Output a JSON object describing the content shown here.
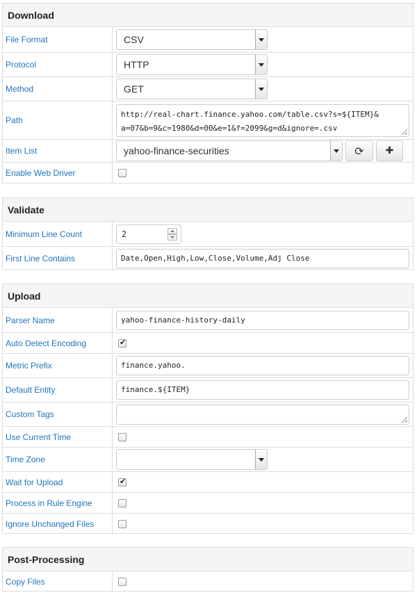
{
  "download": {
    "title": "Download",
    "file_format": {
      "label": "File Format",
      "value": "CSV"
    },
    "protocol": {
      "label": "Protocol",
      "value": "HTTP"
    },
    "method": {
      "label": "Method",
      "value": "GET"
    },
    "path": {
      "label": "Path",
      "line1": "http://real-chart.finance.yahoo.com/table.csv?s=${ITEM}&",
      "line2": "a=07&b=9&c=1980&d=00&e=1&f=2099&g=d&ignore=.csv"
    },
    "item_list": {
      "label": "Item List",
      "value": "yahoo-finance-securities",
      "refresh_icon": "⟳",
      "add_icon": "✚"
    },
    "enable_web_driver": {
      "label": "Enable Web Driver",
      "checked": false
    }
  },
  "validate": {
    "title": "Validate",
    "minimum_line_count": {
      "label": "Minimum Line Count",
      "value": "2"
    },
    "first_line_contains": {
      "label": "First Line Contains",
      "value": "Date,Open,High,Low,Close,Volume,Adj Close"
    }
  },
  "upload": {
    "title": "Upload",
    "parser_name": {
      "label": "Parser Name",
      "value": "yahoo-finance-history-daily"
    },
    "auto_detect_encoding": {
      "label": "Auto Detect Encoding",
      "checked": true
    },
    "metric_prefix": {
      "label": "Metric Prefix",
      "value": "finance.yahoo."
    },
    "default_entity": {
      "label": "Default Entity",
      "value": "finance.${ITEM}"
    },
    "custom_tags": {
      "label": "Custom Tags",
      "value": ""
    },
    "use_current_time": {
      "label": "Use Current Time",
      "checked": false
    },
    "time_zone": {
      "label": "Time Zone",
      "value": ""
    },
    "wait_for_upload": {
      "label": "Wait for Upload",
      "checked": true
    },
    "process_in_rule_engine": {
      "label": "Process in Rule Engine",
      "checked": false
    },
    "ignore_unchanged_files": {
      "label": "Ignore Unchanged Files",
      "checked": false
    }
  },
  "post_processing": {
    "title": "Post-Processing",
    "copy_files": {
      "label": "Copy Files",
      "checked": false
    }
  }
}
